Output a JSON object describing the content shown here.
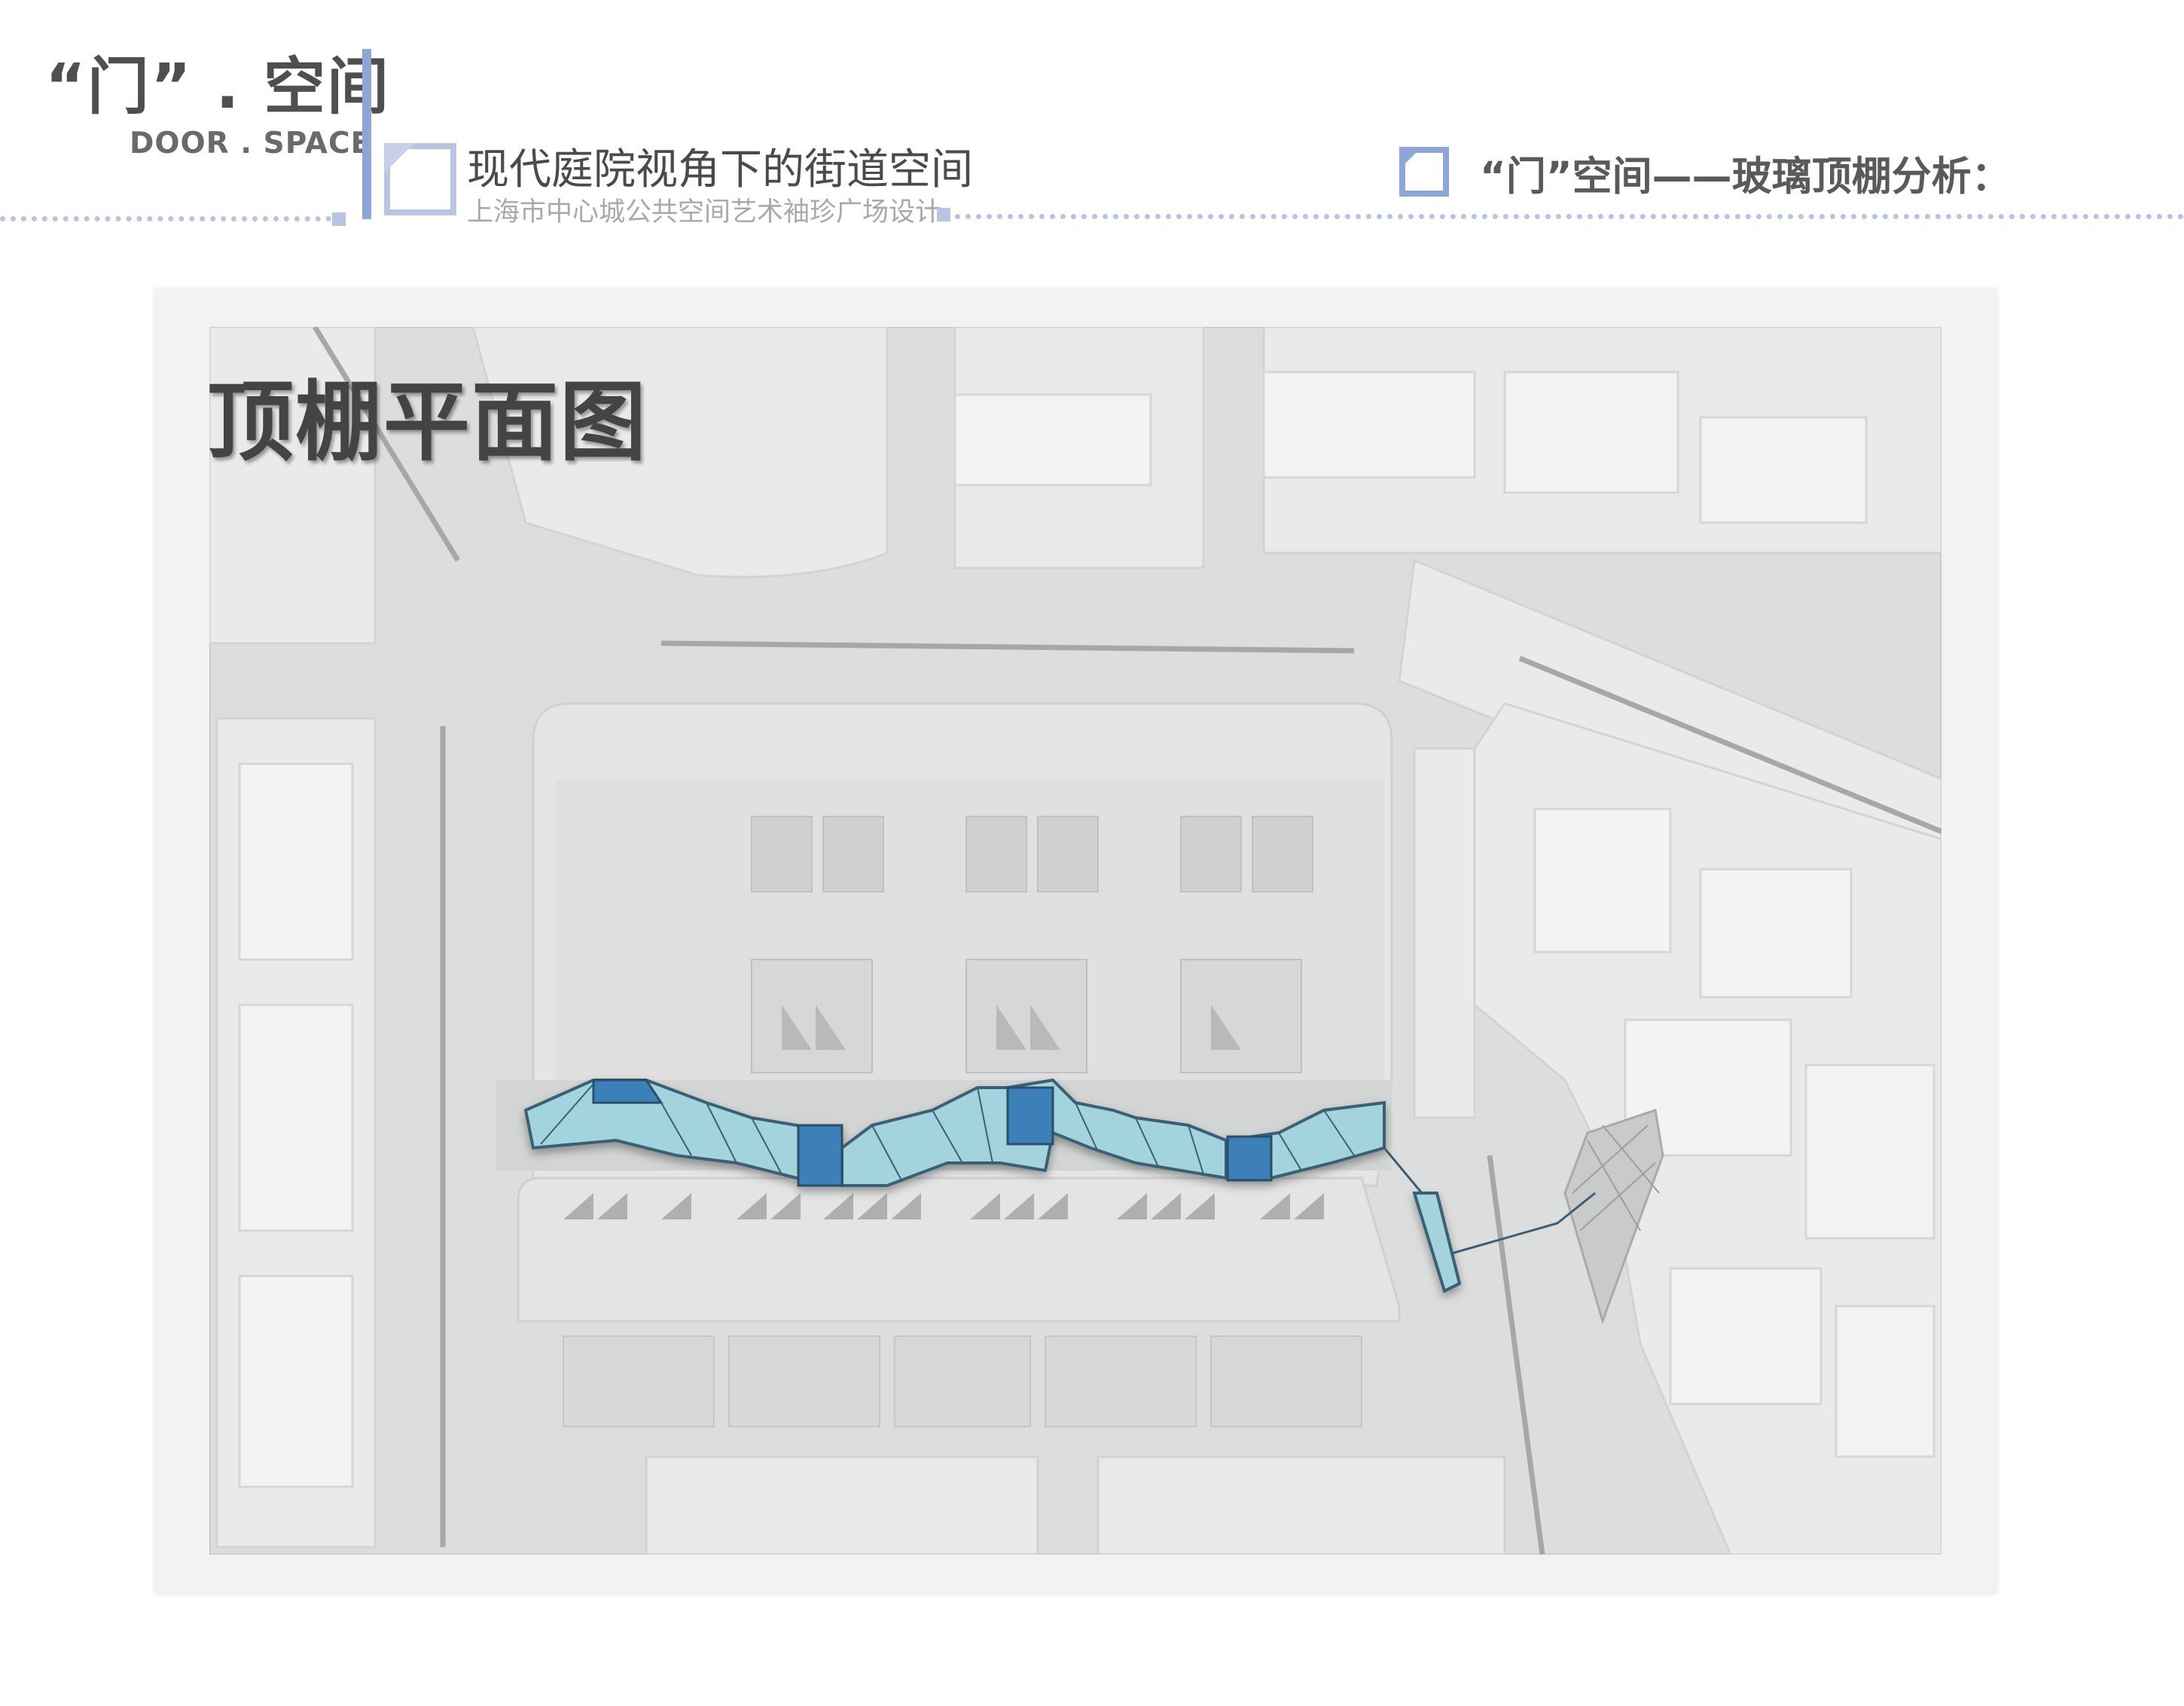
{
  "header": {
    "brand_title": "“门” . 空间",
    "brand_subtitle": "DOOR . SPACE",
    "project_title": "现代庭院视角下的街道空间",
    "project_subtitle": "上海市中心城公共空间艺术袖珍广场设计",
    "section_title": "“门”空间——玻璃顶棚分析："
  },
  "plan": {
    "heading": "顶棚平面图"
  },
  "colors": {
    "accent": "#8ea5d8",
    "dots": "#b9c3e2",
    "glass_light": "#9fcfd9",
    "glass_dark": "#3d7fb8",
    "map_base": "#dcdedd",
    "map_block": "#e9eae9"
  }
}
